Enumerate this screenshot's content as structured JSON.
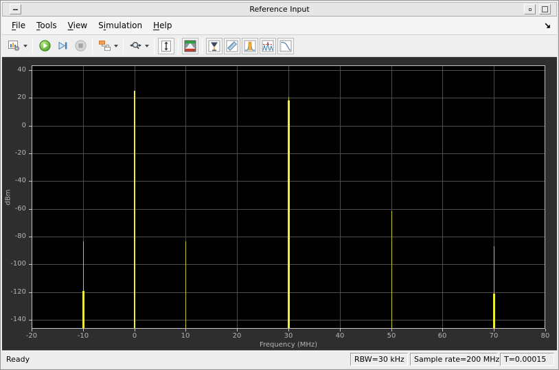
{
  "window": {
    "title": "Reference Input",
    "controls": [
      "window-menu-icon",
      "minimize-icon",
      "maximize-icon"
    ]
  },
  "menu": {
    "items": [
      {
        "label": "File",
        "accel_index": 0
      },
      {
        "label": "Tools",
        "accel_index": 0
      },
      {
        "label": "View",
        "accel_index": 0
      },
      {
        "label": "Simulation",
        "accel_index": 1
      },
      {
        "label": "Help",
        "accel_index": 0
      }
    ],
    "overflow_icon": "dock-arrow-icon"
  },
  "toolbar": {
    "icons": [
      "spectrum-settings-icon",
      "run-icon",
      "step-forward-icon",
      "stop-icon",
      "playback-options-icon",
      "zoom-x-icon",
      "scale-y-axis-icon",
      "spectrum-view-icon",
      "cursor-measurements-icon",
      "distortion-measurements-icon",
      "channel-measurements-icon",
      "peak-finder-icon",
      "ccdf-measurements-icon"
    ]
  },
  "status_bar": {
    "state": "Ready",
    "rbw": "RBW=30 kHz",
    "sample_rate": "Sample rate=200 MHz",
    "time": "T=0.00015"
  },
  "chart_data": {
    "type": "line",
    "subtype": "spectrum-spikes",
    "title": "",
    "xlabel": "Frequency (MHz)",
    "ylabel": "dBm",
    "xlim": [
      -20,
      80
    ],
    "ylim": [
      -146.4,
      43.5
    ],
    "xticks": [
      -20,
      -10,
      0,
      10,
      20,
      30,
      40,
      50,
      60,
      70,
      80
    ],
    "yticks": [
      40,
      20,
      0,
      -20,
      -40,
      -60,
      -80,
      -100,
      -120,
      -140
    ],
    "grid": true,
    "legend": false,
    "colors": {
      "background": "#000000",
      "grid": "#4d4d4d",
      "frame": "#c4c4c4",
      "tick_label": "#b4b4b4",
      "line_dim": "#c9c52a",
      "line_bright": "#f2ee35"
    },
    "spikes": [
      {
        "freq_mhz": -10,
        "peak_dbm": -83.5,
        "thin_width": 1,
        "bright_from_dbm": -119
      },
      {
        "freq_mhz": 0,
        "peak_dbm": 25,
        "thin_width": 2,
        "bright_from_dbm": null
      },
      {
        "freq_mhz": 10,
        "peak_dbm": -83.5,
        "thin_width": 1,
        "bright_from_dbm": null
      },
      {
        "freq_mhz": 30,
        "peak_dbm": 20.5,
        "thin_width": 1,
        "bright_from_dbm": 18
      },
      {
        "freq_mhz": 50,
        "peak_dbm": -61.5,
        "thin_width": 1,
        "bright_from_dbm": null
      },
      {
        "freq_mhz": 70,
        "peak_dbm": -87,
        "thin_width": 1,
        "bright_from_dbm": -121
      }
    ]
  }
}
